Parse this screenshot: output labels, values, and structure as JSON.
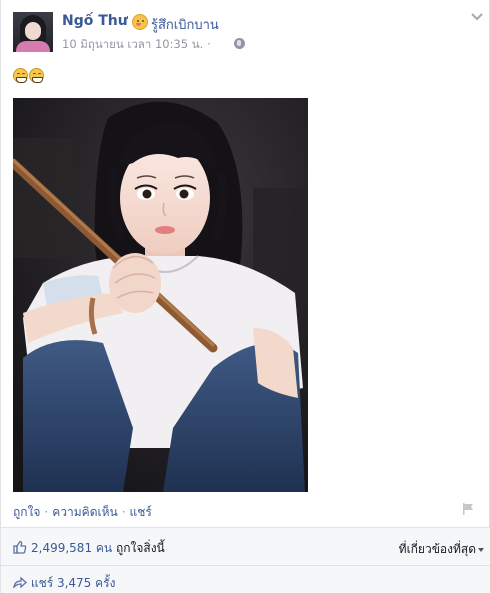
{
  "post": {
    "author_name": "Ngố Thư",
    "feeling_icon": "smiling-face-icon",
    "feeling_text": "รู้สึกเบิกบาน",
    "timestamp": "10 มิถุนายน เวลา 10:35 น.",
    "meta_separator": "·",
    "privacy_icon": "globe-icon",
    "status_emoji_icons": [
      "grinning-face-icon",
      "grinning-face-icon"
    ],
    "photo_icon": "photo-of-girl-in-white-shirt"
  },
  "actions": {
    "like_label": "ถูกใจ",
    "comment_label": "ความคิดเห็น",
    "share_label": "แชร์",
    "separator": "·",
    "flag_icon": "flag-icon"
  },
  "ufi": {
    "likes_count": "2,499,581 คน",
    "likes_text": "ถูกใจสิ่งนี้",
    "sort_label": "ที่เกี่ยวข้องที่สุด",
    "shares_text": "แชร์ 3,475 ครั้ง"
  },
  "colors": {
    "link": "#3b5998",
    "meta": "#9197a3",
    "ufi_background": "#f6f7f8"
  }
}
